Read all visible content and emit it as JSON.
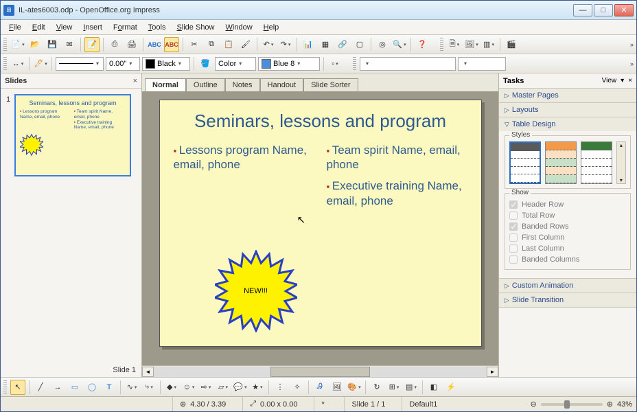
{
  "window": {
    "title": "IL-ates6003.odp - OpenOffice.org Impress"
  },
  "menus": {
    "file": "File",
    "edit": "Edit",
    "view": "View",
    "insert": "Insert",
    "format": "Format",
    "tools": "Tools",
    "slideshow": "Slide Show",
    "window": "Window",
    "help": "Help"
  },
  "toolbar2": {
    "linewidth": "0.00\"",
    "linecolor": "Black",
    "filllabel": "Color",
    "fillcolor": "Blue 8"
  },
  "slidesPanel": {
    "title": "Slides",
    "footer": "Slide 1"
  },
  "slideThumb": {
    "title": "Seminars, lessons and program",
    "c1a": "Lessons program Name, email, phone",
    "c2a": "Team spirit Name, email, phone",
    "c2b": "Executive training Name, email, phone"
  },
  "tabs": {
    "normal": "Normal",
    "outline": "Outline",
    "notes": "Notes",
    "handout": "Handout",
    "sorter": "Slide Sorter"
  },
  "slide": {
    "title": "Seminars, lessons and program",
    "b1": "Lessons program Name, email, phone",
    "b2": "Team spirit Name, email, phone",
    "b3": "Executive training Name, email, phone",
    "star": "NEW!!!"
  },
  "tasks": {
    "title": "Tasks",
    "view": "View",
    "master": "Master Pages",
    "layouts": "Layouts",
    "table": "Table Design",
    "styles": "Styles",
    "show": "Show",
    "headerrow": "Header Row",
    "totalrow": "Total Row",
    "bandedrows": "Banded Rows",
    "firstcol": "First Column",
    "lastcol": "Last Column",
    "bandedcols": "Banded Columns",
    "custanim": "Custom Animation",
    "slidetrans": "Slide Transition"
  },
  "status": {
    "pos": "4.30 / 3.39",
    "size": "0.00 x 0.00",
    "slide": "Slide 1 / 1",
    "master": "Default1",
    "zoom": "43%"
  }
}
